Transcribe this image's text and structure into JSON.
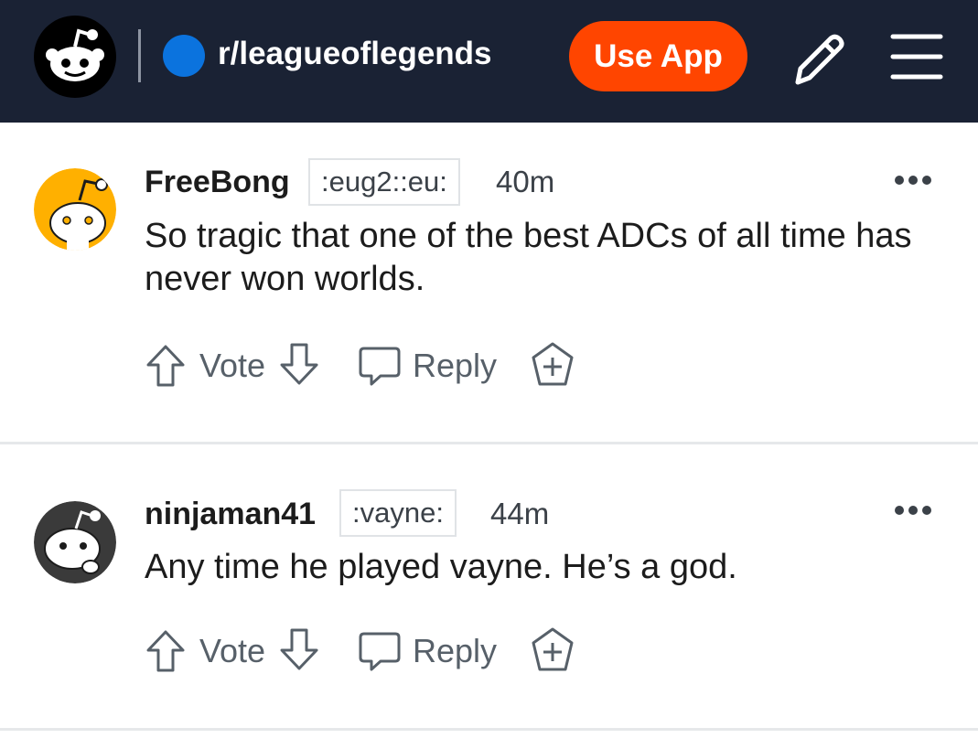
{
  "header": {
    "subreddit": "r/leagueoflegends",
    "use_app_label": "Use App",
    "logo_icon": "reddit-snoo-icon",
    "edit_icon": "pencil-icon",
    "menu_icon": "hamburger-menu-icon",
    "colors": {
      "bar": "#1a2234",
      "accent": "#ff4500",
      "sub_dot": "#0b73de"
    }
  },
  "comments": [
    {
      "author": "FreeBong",
      "flair": ":eug2::eu:",
      "time": "40m",
      "body": "So tragic that one of the best ADCs of all time has never won worlds.",
      "vote_label": "Vote",
      "reply_label": "Reply",
      "avatar_color": "#ffb000"
    },
    {
      "author": "ninjaman41",
      "flair": ":vayne:",
      "time": "44m",
      "body": "Any time he played vayne. He’s a god.",
      "vote_label": "Vote",
      "reply_label": "Reply",
      "avatar_color": "#3a3a3a"
    }
  ]
}
